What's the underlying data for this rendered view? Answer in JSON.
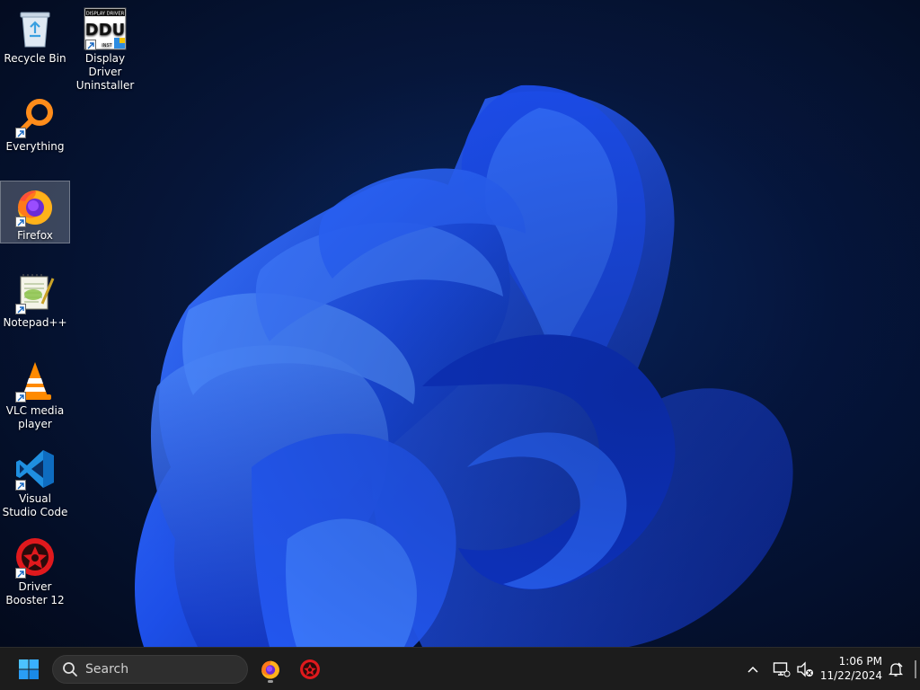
{
  "desktop": {
    "icons": [
      {
        "label": "Recycle Bin",
        "icon": "recycle-bin-icon"
      },
      {
        "label": "Display Driver Uninstaller",
        "icon": "ddu-icon",
        "icon_text_top": "DISPLAY DRIVER",
        "icon_text_main": "DDU",
        "icon_text_bottom": "INST"
      },
      {
        "label": "Everything",
        "icon": "everything-search-icon"
      },
      {
        "label": "Firefox",
        "icon": "firefox-icon",
        "selected": true
      },
      {
        "label": "Notepad++",
        "icon": "notepad-plus-plus-icon"
      },
      {
        "label": "VLC media player",
        "icon": "vlc-cone-icon"
      },
      {
        "label": "Visual Studio Code",
        "icon": "vscode-icon"
      },
      {
        "label": "Driver Booster 12",
        "icon": "driver-booster-icon"
      }
    ]
  },
  "taskbar": {
    "search_label": "Search",
    "pinned": [
      {
        "name": "Firefox",
        "icon": "firefox-icon",
        "running": true
      },
      {
        "name": "Driver Booster 12",
        "icon": "driver-booster-icon",
        "running": false
      }
    ],
    "time": "1:06 PM",
    "date": "11/22/2024"
  },
  "colors": {
    "taskbar_bg": "#1c1c1c",
    "accent": "#1a6ff0",
    "wallpaper_blue": "#1f4fe0"
  }
}
